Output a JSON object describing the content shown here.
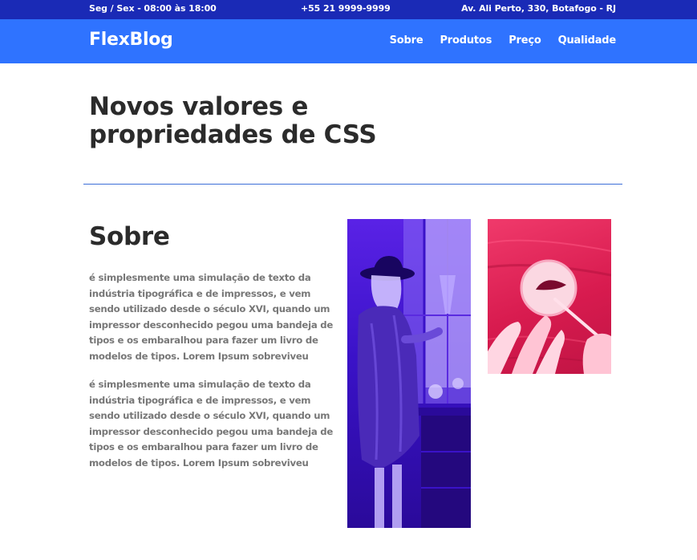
{
  "topbar": {
    "hours": "Seg / Sex - 08:00 às 18:00",
    "phone": "+55 21 9999-9999",
    "address": "Av. Ali Perto, 330, Botafogo - RJ"
  },
  "header": {
    "logo": "FlexBlog",
    "nav": [
      "Sobre",
      "Produtos",
      "Preço",
      "Qualidade"
    ]
  },
  "main": {
    "title": "Novos valores e propriedades de CSS"
  },
  "about": {
    "heading": "Sobre",
    "paragraphs": [
      "é simplesmente uma simulação de texto da indústria tipográfica e de impressos, e vem sendo utilizado desde o século XVI, quando um impressor desconhecido pegou uma bandeja de tipos e os embaralhou para fazer um livro de modelos de tipos. Lorem Ipsum sobreviveu",
      "é simplesmente uma simulação de texto da indústria tipográfica e de impressos, e vem sendo utilizado desde o século XVI, quando um impressor desconhecido pegou uma bandeja de tipos e os embaralhou para fazer um livro de modelos de tipos. Lorem Ipsum sobreviveu"
    ]
  },
  "colors": {
    "topbar": "#1a2ab6",
    "navbar": "#2f73ff",
    "divider": "#3d6fd8",
    "woman_photo_tint": "#4a1ae0",
    "hands_photo_tint": "#e0245a"
  }
}
